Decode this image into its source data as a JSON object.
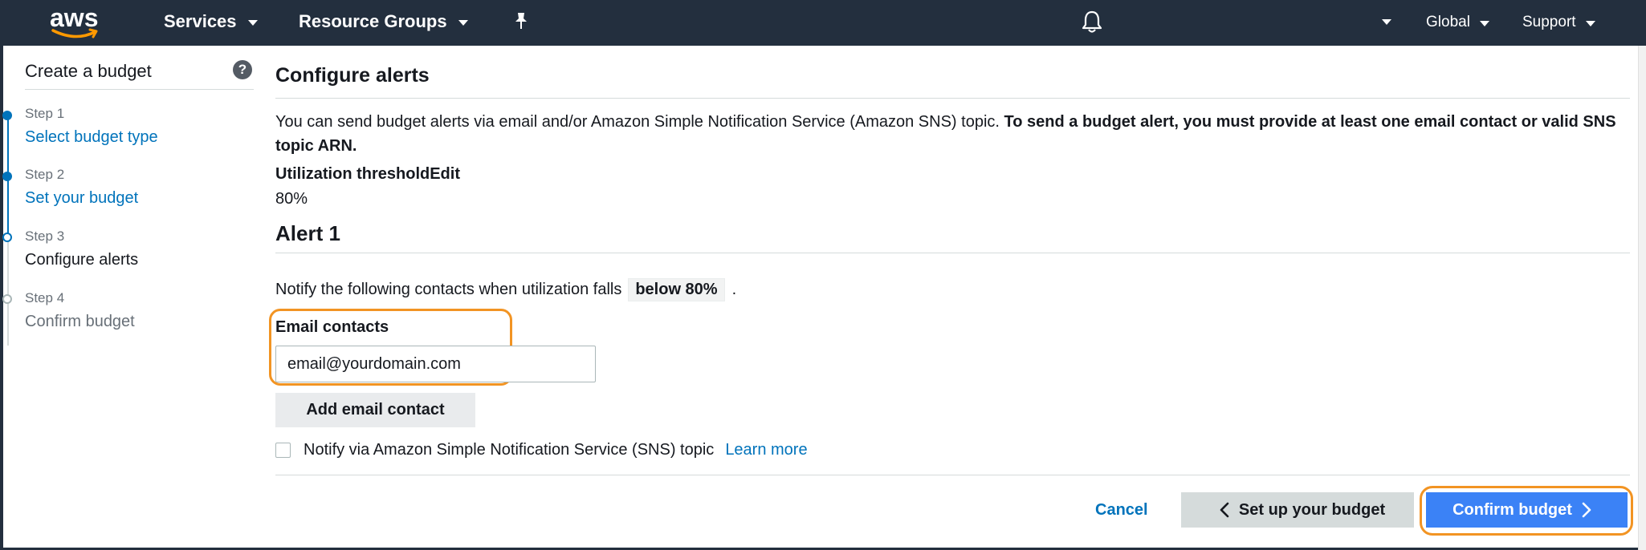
{
  "nav": {
    "logo": "aws",
    "services": "Services",
    "resource_groups": "Resource Groups",
    "region": "Global",
    "support": "Support"
  },
  "sidebar": {
    "title": "Create a budget",
    "steps": [
      {
        "num": "Step 1",
        "label": "Select budget type",
        "state": "done"
      },
      {
        "num": "Step 2",
        "label": "Set your budget",
        "state": "done"
      },
      {
        "num": "Step 3",
        "label": "Configure alerts",
        "state": "current"
      },
      {
        "num": "Step 4",
        "label": "Confirm budget",
        "state": "future"
      }
    ]
  },
  "main": {
    "title": "Configure alerts",
    "intro": "You can send budget alerts via email and/or Amazon Simple Notification Service (Amazon SNS) topic.",
    "intro_bold": "To send a budget alert, you must provide at least one email contact or valid SNS topic ARN.",
    "threshold_label": "Utilization thresholdEdit",
    "threshold_value": "80%",
    "alert_title": "Alert 1",
    "notify_text": "Notify the following contacts when utilization falls",
    "notify_chip": "below 80%",
    "notify_end": ".",
    "email_label": "Email contacts",
    "email_value": "email@yourdomain.com",
    "add_email_button": "Add email contact",
    "sns_text": "Notify via Amazon Simple Notification Service (SNS) topic",
    "learn_more": "Learn more"
  },
  "footer": {
    "cancel": "Cancel",
    "back": "Set up your budget",
    "confirm": "Confirm budget"
  },
  "colors": {
    "nav_bg": "#232f3e",
    "link": "#0073bb",
    "primary_button": "#3b82f6",
    "highlight": "#f29423"
  }
}
